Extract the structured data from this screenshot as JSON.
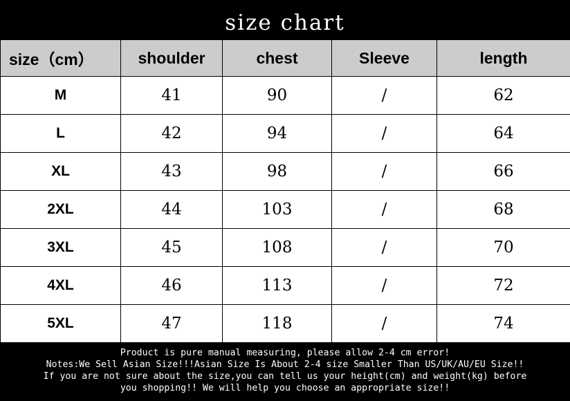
{
  "title": "size chart",
  "table": {
    "headers": [
      "size（cm）",
      "shoulder",
      "chest",
      "Sleeve",
      "length"
    ],
    "rows": [
      [
        "M",
        "41",
        "90",
        "/",
        "62"
      ],
      [
        "L",
        "42",
        "94",
        "/",
        "64"
      ],
      [
        "XL",
        "43",
        "98",
        "/",
        "66"
      ],
      [
        "2XL",
        "44",
        "103",
        "/",
        "68"
      ],
      [
        "3XL",
        "45",
        "108",
        "/",
        "70"
      ],
      [
        "4XL",
        "46",
        "113",
        "/",
        "72"
      ],
      [
        "5XL",
        "47",
        "118",
        "/",
        "74"
      ]
    ]
  },
  "notes": [
    "Product is pure manual measuring, please allow 2-4 cm error!",
    "Notes:We Sell Asian Size!!!Asian Size Is About 2-4 size Smaller Than US/UK/AU/EU Size!!",
    "If you are not sure about the size,you can tell us your height(cm) and weight(kg) before",
    "you shopping!! We will help you choose an appropriate size!!"
  ],
  "colors": {
    "background": "#000000",
    "header_row": "#cccccc",
    "cell": "#ffffff",
    "text_dark": "#000000",
    "text_light": "#ffffff"
  }
}
